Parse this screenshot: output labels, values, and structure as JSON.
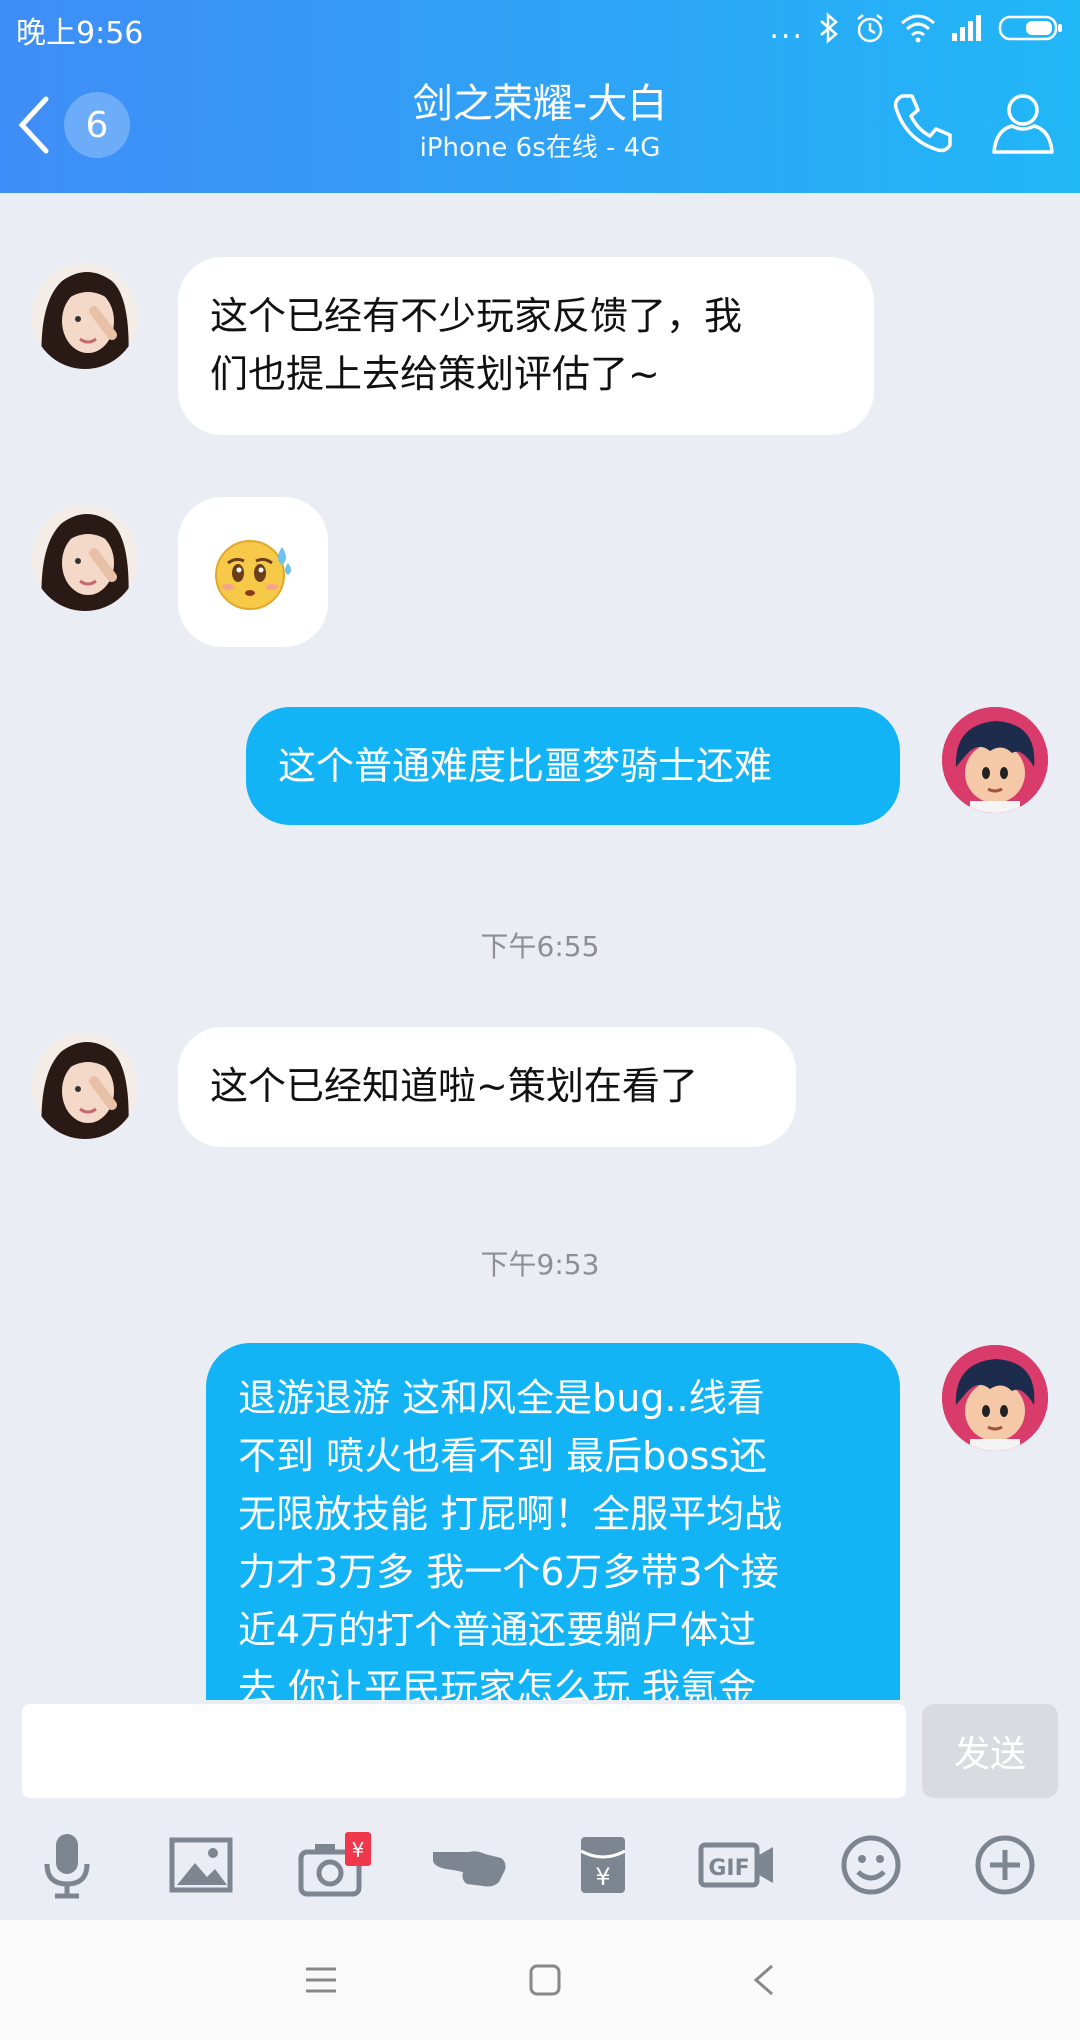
{
  "status_bar": {
    "time": "晚上9:56",
    "dots": "..."
  },
  "header": {
    "unread_count": "6",
    "title": "剑之荣耀-大白",
    "subtitle": "iPhone 6s在线 - 4G"
  },
  "messages": [
    {
      "side": "in",
      "type": "text",
      "text_lines": [
        "这个已经有不少玩家反馈了，我",
        "们也提上去给策划评估了~"
      ]
    },
    {
      "side": "in",
      "type": "emoji",
      "emoji": "😰"
    },
    {
      "side": "out",
      "type": "text",
      "text_lines": [
        "这个普通难度比噩梦骑士还难"
      ]
    },
    {
      "type": "time",
      "text": "下午6:55"
    },
    {
      "side": "in",
      "type": "text",
      "text_lines": [
        "这个已经知道啦~策划在看了"
      ]
    },
    {
      "type": "time",
      "text": "下午9:53"
    },
    {
      "side": "out",
      "type": "text",
      "text_lines": [
        "退游退游  这和风全是bug..线看",
        "不到  喷火也看不到  最后boss还",
        "无限放技能  打屁啊！全服平均战",
        "力才3万多 我一个6万多带3个接",
        "近4万的打个普通还要躺尸体过",
        "去 你让平民玩家怎么玩 我氪金"
      ]
    }
  ],
  "input": {
    "placeholder": "",
    "send_label": "发送"
  },
  "toolbar": [
    "microphone-icon",
    "image-icon",
    "camera-redpacket-icon",
    "poke-icon",
    "redpacket-icon",
    "gif-icon",
    "emoji-icon",
    "plus-icon"
  ],
  "colors": {
    "header_start": "#3f8df6",
    "header_end": "#21b7f7",
    "outgoing_bubble": "#12b4f5",
    "chat_bg": "#ebedf5"
  }
}
